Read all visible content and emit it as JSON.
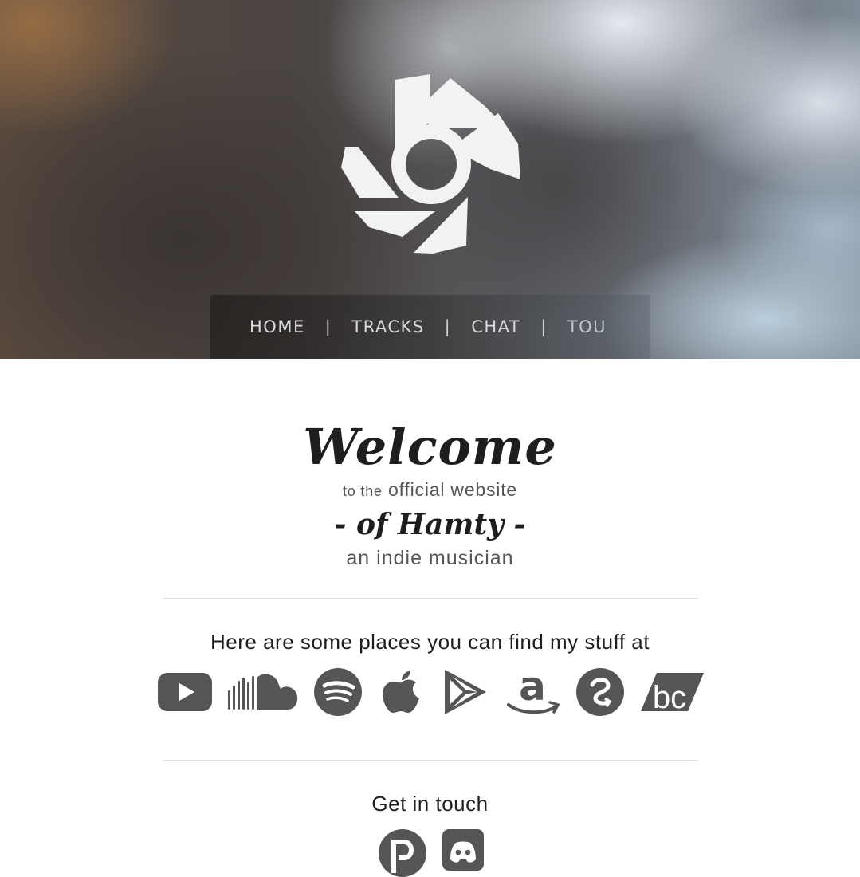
{
  "nav": {
    "items": [
      {
        "label": "HOME"
      },
      {
        "label": "TRACKS"
      },
      {
        "label": "CHAT"
      },
      {
        "label": "TOU"
      }
    ],
    "separator": "|"
  },
  "welcome": {
    "title": "Welcome",
    "line1_small": "to the",
    "line1_rest": "official website",
    "artist_line": "- of Hamty -",
    "line2": "an indie musician"
  },
  "stores": {
    "heading": "Here are some places you can find my stuff at",
    "icons": [
      "youtube-icon",
      "soundcloud-icon",
      "spotify-icon",
      "apple-music-icon",
      "google-play-icon",
      "amazon-icon",
      "deezer-icon",
      "bandcamp-icon"
    ]
  },
  "contact": {
    "heading": "Get in touch",
    "icons": [
      "patreon-icon",
      "discord-icon"
    ]
  },
  "colors": {
    "icon_gray": "#555555",
    "text_dark": "#1e1e1e",
    "nav_text": "#d9d9d9"
  }
}
